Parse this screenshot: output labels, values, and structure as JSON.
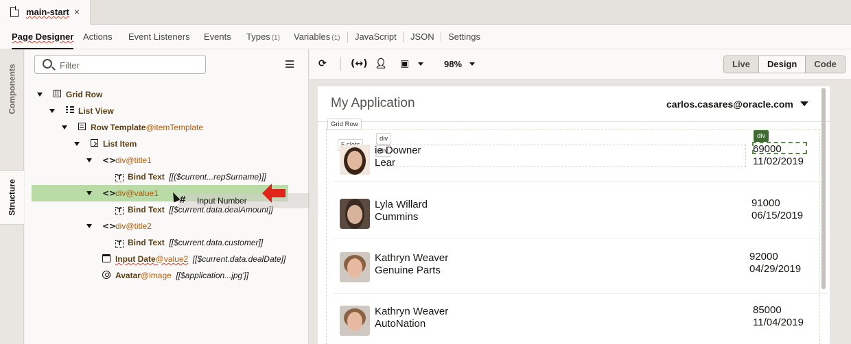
{
  "file_tab": {
    "title": "main-start",
    "close": "×"
  },
  "designer_tabs": [
    {
      "label": "Page Designer",
      "count": ""
    },
    {
      "label": "Actions",
      "count": ""
    },
    {
      "label": "Event Listeners",
      "count": ""
    },
    {
      "label": "Events",
      "count": ""
    },
    {
      "label": "Types",
      "count": "(1)"
    },
    {
      "label": "Variables",
      "count": "(1)"
    },
    {
      "label": "JavaScript",
      "count": ""
    },
    {
      "label": "JSON",
      "count": ""
    },
    {
      "label": "Settings",
      "count": ""
    }
  ],
  "side_tabs": {
    "components": "Components",
    "structure": "Structure"
  },
  "structure": {
    "filter_placeholder": "Filter",
    "tree": [
      {
        "name": "Grid Row",
        "suffix": "",
        "binding": ""
      },
      {
        "name": "List View",
        "suffix": "",
        "binding": ""
      },
      {
        "name": "Row Template",
        "suffix": "@itemTemplate",
        "binding": ""
      },
      {
        "name": "List Item",
        "suffix": "",
        "binding": ""
      },
      {
        "name": "",
        "suffix": "div@title1",
        "binding": ""
      },
      {
        "name": "Bind Text",
        "suffix": "",
        "binding": "[[($current...repSurname)]]"
      },
      {
        "name": "",
        "suffix": "div@value1",
        "binding": ""
      },
      {
        "name": "Bind Text",
        "suffix": "",
        "binding": "[[$current.data.dealAmount]]"
      },
      {
        "name": "",
        "suffix": "div@title2",
        "binding": ""
      },
      {
        "name": "Bind Text",
        "suffix": "",
        "binding": "[[$current.data.customer]]"
      },
      {
        "name": "Input Date",
        "suffix": "@value2",
        "binding": "[[$current.data.dealDate]]"
      },
      {
        "name": "Avatar",
        "suffix": "@image",
        "binding": "[[$application...jpg']]"
      }
    ],
    "drag_ghost_label": "Input Number",
    "drag_ghost_icon": "#"
  },
  "toolbar": {
    "zoom": "98%",
    "modes": [
      "Live",
      "Design",
      "Code"
    ],
    "active_mode": "Design"
  },
  "app": {
    "title": "My Application",
    "user": "carlos.casares@oracle.com",
    "chips": {
      "grid_row": "Grid Row",
      "slots": "5 slots",
      "div_a": "div",
      "div_b": "div",
      "div_selected": "div"
    },
    "rows": [
      {
        "name1": "ie Downer",
        "name2": "Lear",
        "amount": "69000",
        "date": "11/02/2019"
      },
      {
        "name1": "Lyla Willard",
        "name2": "Cummins",
        "amount": "91000",
        "date": "06/15/2019"
      },
      {
        "name1": "Kathryn Weaver",
        "name2": "Genuine Parts",
        "amount": "92000",
        "date": "04/29/2019"
      },
      {
        "name1": "Kathryn Weaver",
        "name2": "AutoNation",
        "amount": "85000",
        "date": "11/04/2019"
      }
    ]
  },
  "colors": {
    "selected_row": "#b9dca6",
    "accent_red": "#e2231a",
    "chip_green": "#3f6a32"
  }
}
